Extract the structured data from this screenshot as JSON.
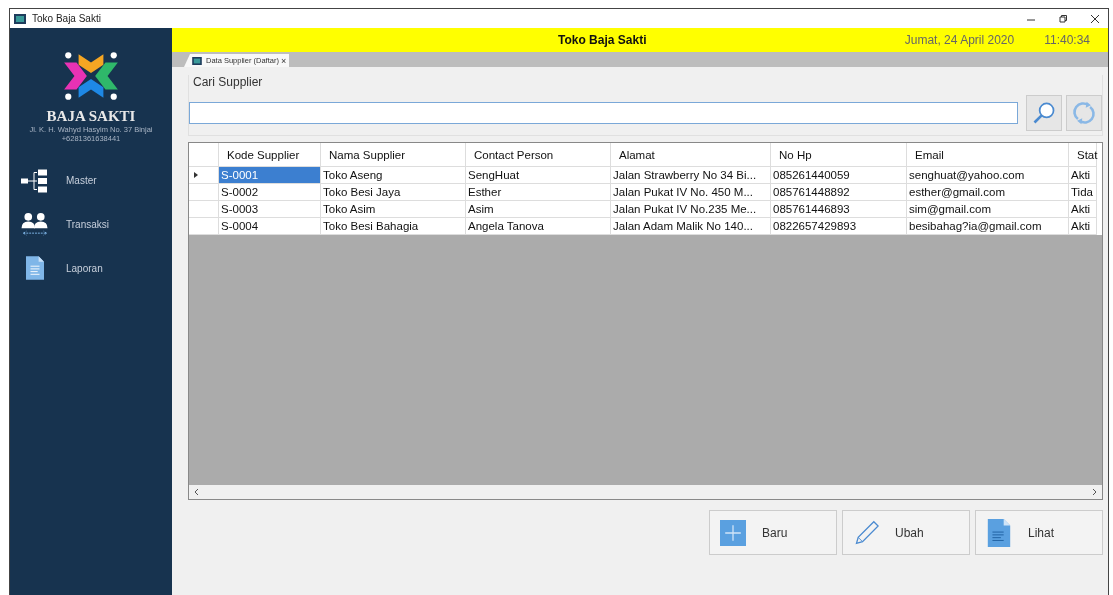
{
  "window": {
    "title": "Toko Baja Sakti"
  },
  "header": {
    "title": "Toko Baja Sakti",
    "date": "Jumat, 24 April 2020",
    "time": "11:40:34"
  },
  "sidebar": {
    "brand": "BAJA SAKTI",
    "address": "Jl. K. H. Wahyd Hasyim No. 37 Binjai",
    "phone": "+6281361638441",
    "items": [
      {
        "kind": "master",
        "label": "Master"
      },
      {
        "kind": "transaksi",
        "label": "Transaksi"
      },
      {
        "kind": "laporan",
        "label": "Laporan"
      }
    ]
  },
  "tabs": [
    {
      "label": "Data Supplier (Daftar)",
      "close": "×",
      "selected": true
    }
  ],
  "search": {
    "label": "Cari Supplier"
  },
  "table": {
    "columns": [
      "Kode Supplier",
      "Nama Supplier",
      "Contact Person",
      "Alamat",
      "No Hp",
      "Email",
      "Stat"
    ],
    "rows": [
      {
        "selected": true,
        "cells": [
          "S-0001",
          "Toko Aseng",
          "SengHuat",
          "Jalan Strawberry No 34 Bi...",
          "085261440059",
          "senghuat@yahoo.com",
          "Akti"
        ]
      },
      {
        "selected": false,
        "cells": [
          "S-0002",
          "Toko Besi Jaya",
          "Esther",
          "Jalan Pukat IV No. 450 M...",
          "085761448892",
          "esther@gmail.com",
          "Tida"
        ]
      },
      {
        "selected": false,
        "cells": [
          "S-0003",
          "Toko Asim",
          "Asim",
          "Jalan Pukat IV No.235 Me...",
          "085761446893",
          "sim@gmail.com",
          "Akti"
        ]
      },
      {
        "selected": false,
        "cells": [
          "S-0004",
          "Toko Besi Bahagia",
          "Angela Tanova",
          "Jalan Adam Malik No 140...",
          "0822657429893",
          "besibahag?ia@gmail.com",
          "Akti"
        ]
      }
    ]
  },
  "buttons": [
    {
      "kind": "add",
      "label": "Baru"
    },
    {
      "kind": "edit",
      "label": "Ubah"
    },
    {
      "kind": "view",
      "label": "Lihat"
    }
  ]
}
